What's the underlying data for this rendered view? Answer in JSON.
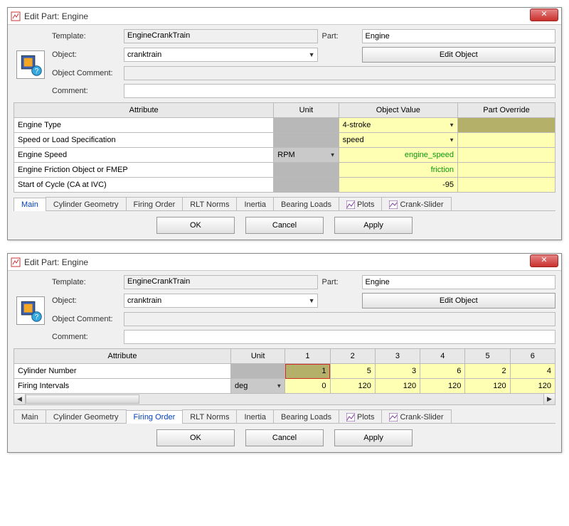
{
  "dialog1": {
    "title": "Edit Part: Engine",
    "labels": {
      "template": "Template:",
      "object": "Object:",
      "object_comment": "Object Comment:",
      "comment": "Comment:",
      "part": "Part:"
    },
    "fields": {
      "template": "EngineCrankTrain",
      "object": "cranktrain",
      "object_comment": "",
      "comment": "",
      "part": "Engine",
      "edit_object_btn": "Edit Object"
    },
    "grid": {
      "headers": {
        "attribute": "Attribute",
        "unit": "Unit",
        "object_value": "Object Value",
        "part_override": "Part Override"
      },
      "rows": [
        {
          "attr": "Engine Type",
          "unit": "",
          "val": "4-stroke",
          "val_type": "select",
          "override": "",
          "override_olive": true
        },
        {
          "attr": "Speed or Load Specification",
          "unit": "",
          "val": "speed",
          "val_type": "select",
          "override": ""
        },
        {
          "attr": "Engine Speed",
          "unit": "RPM",
          "unit_type": "select",
          "val": "engine_speed",
          "val_green": true,
          "override": ""
        },
        {
          "attr": "Engine Friction Object or FMEP",
          "unit": "",
          "val": "friction",
          "val_green": true,
          "override": ""
        },
        {
          "attr": "Start of Cycle (CA at IVC)",
          "unit": "",
          "val": "-95",
          "override": ""
        }
      ]
    },
    "tabs": [
      "Main",
      "Cylinder Geometry",
      "Firing Order",
      "RLT Norms",
      "Inertia",
      "Bearing Loads",
      "Plots",
      "Crank-Slider"
    ],
    "active_tab": "Main",
    "buttons": {
      "ok": "OK",
      "cancel": "Cancel",
      "apply": "Apply"
    }
  },
  "dialog2": {
    "title": "Edit Part: Engine",
    "labels": {
      "template": "Template:",
      "object": "Object:",
      "object_comment": "Object Comment:",
      "comment": "Comment:",
      "part": "Part:"
    },
    "fields": {
      "template": "EngineCrankTrain",
      "object": "cranktrain",
      "object_comment": "",
      "comment": "",
      "part": "Engine",
      "edit_object_btn": "Edit Object"
    },
    "grid": {
      "headers": {
        "attribute": "Attribute",
        "unit": "Unit",
        "c1": "1",
        "c2": "2",
        "c3": "3",
        "c4": "4",
        "c5": "5",
        "c6": "6"
      },
      "rows": [
        {
          "attr": "Cylinder Number",
          "unit": "",
          "v": [
            "1",
            "5",
            "3",
            "6",
            "2",
            "4"
          ],
          "hl0": true
        },
        {
          "attr": "Firing Intervals",
          "unit": "deg",
          "unit_type": "select",
          "v": [
            "0",
            "120",
            "120",
            "120",
            "120",
            "120"
          ]
        }
      ]
    },
    "tabs": [
      "Main",
      "Cylinder Geometry",
      "Firing Order",
      "RLT Norms",
      "Inertia",
      "Bearing Loads",
      "Plots",
      "Crank-Slider"
    ],
    "active_tab": "Firing Order",
    "buttons": {
      "ok": "OK",
      "cancel": "Cancel",
      "apply": "Apply"
    }
  }
}
